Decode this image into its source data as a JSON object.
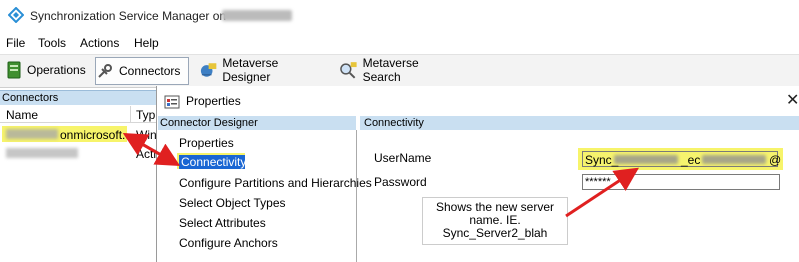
{
  "window": {
    "title": "Synchronization Service Manager on"
  },
  "menu": [
    "File",
    "Tools",
    "Actions",
    "Help"
  ],
  "toolbar": {
    "operations": "Operations",
    "connectors": "Connectors",
    "metaverse_designer": "Metaverse Designer",
    "metaverse_search": "Metaverse Search"
  },
  "connectors_pane": {
    "header": "Connectors",
    "columns": [
      "Name",
      "Typ"
    ],
    "rows": [
      {
        "name_suffix": "onmicrosoft...",
        "type": "Win"
      },
      {
        "name_suffix": "",
        "type": "Acti"
      }
    ]
  },
  "dialog": {
    "title": "Properties",
    "close_glyph": "✕",
    "designer_header": "Connector Designer",
    "items": [
      "Properties",
      "Connectivity",
      "Configure Partitions and Hierarchies",
      "Select Object Types",
      "Select Attributes",
      "Configure Anchors"
    ],
    "selected_arrow": "⇨",
    "connectivity_header": "Connectivity",
    "username_label": "UserName",
    "password_label": "Password",
    "username_value_start": "Sync_",
    "username_value_mid": "_ec",
    "username_value_end": "@",
    "password_value": "******"
  },
  "annotation": {
    "lines": [
      "Shows the new server",
      "name.  IE.",
      "Sync_Server2_blah"
    ],
    "arrow_color": "#e02020",
    "highlight_color": "#f7f46a"
  },
  "colors": {
    "header_blue": "#c9dff1",
    "selection_blue": "#1a66d3"
  }
}
